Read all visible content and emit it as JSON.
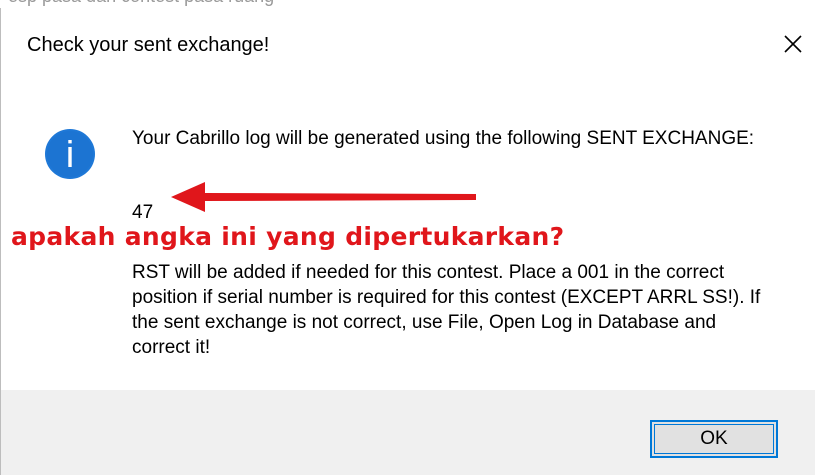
{
  "background": {
    "partial_text": "esp pasa dan contest pasa ruang"
  },
  "dialog": {
    "title": "Check your sent exchange!",
    "close_icon": "close-icon",
    "message_icon": "info-icon",
    "message": "Your Cabrillo log will be generated using the following SENT EXCHANGE:",
    "exchange_value": "47",
    "annotation": "apakah angka ini yang dipertukarkan?",
    "note": "RST will be added if needed for this contest.  Place a 001 in the correct position if serial number is required for this contest (EXCEPT ARRL SS!).  If the sent exchange is not correct, use File, Open Log in Database and correct it!",
    "ok_label": "OK"
  },
  "colors": {
    "annotation": "#e0161b",
    "info_icon": "#1e78d7",
    "ok_border": "#0078d7",
    "footer": "#f0f0f0"
  }
}
